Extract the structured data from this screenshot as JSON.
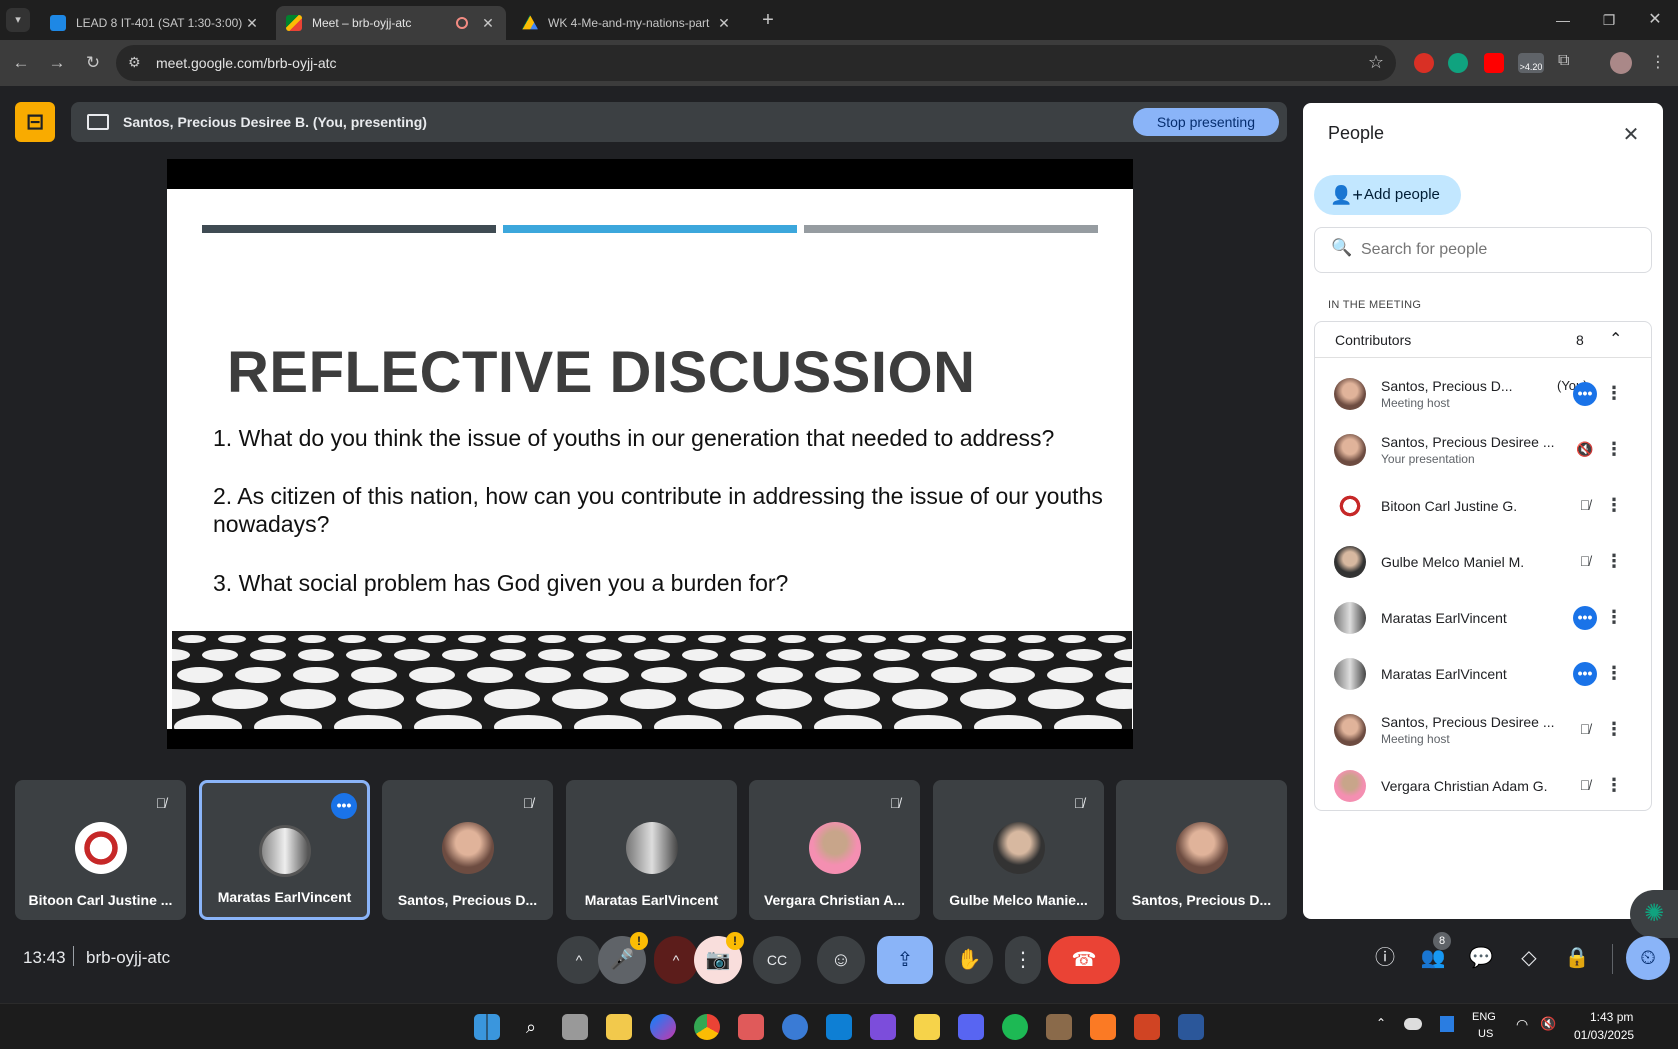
{
  "browser": {
    "tabs": [
      {
        "title": "LEAD 8 IT-401 (SAT 1:30-3:00)",
        "favicon": "classroom-icon"
      },
      {
        "title": "Meet – brb-oyjj-atc",
        "favicon": "meet-icon"
      },
      {
        "title": "WK 4-Me-and-my-nations-part",
        "favicon": "drive-icon"
      }
    ],
    "url": "meet.google.com/brb-oyjj-atc",
    "badge": ">4.20"
  },
  "presenting": {
    "label": "Santos, Precious Desiree B. (You, presenting)",
    "stop_label": "Stop presenting"
  },
  "slide": {
    "title": "REFLECTIVE DISCUSSION",
    "questions": [
      "1. What do you think the issue of youths in our generation that needed to address?",
      "2. As citizen of this nation, how can you contribute in addressing the issue of our youths nowadays?",
      "3. What social problem has God given you a burden for?"
    ]
  },
  "tiles": [
    {
      "name": "Bitoon Carl Justine ...",
      "muted": true
    },
    {
      "name": "Maratas EarlVincent",
      "muted": false,
      "selected": true
    },
    {
      "name": "Santos, Precious D...",
      "muted": true
    },
    {
      "name": "Maratas EarlVincent",
      "muted": false
    },
    {
      "name": "Vergara Christian A...",
      "muted": true
    },
    {
      "name": "Gulbe Melco Manie...",
      "muted": true
    },
    {
      "name": "Santos, Precious D...",
      "muted": false
    }
  ],
  "people": {
    "title": "People",
    "add_label": "Add people",
    "search_placeholder": "Search for people",
    "section": "IN THE MEETING",
    "group_label": "Contributors",
    "group_count": "8",
    "members": [
      {
        "name": "Santos, Precious D...",
        "you": "(You)",
        "sub": "Meeting host",
        "status": "more"
      },
      {
        "name": "Santos, Precious Desiree ...",
        "sub": "Your presentation",
        "status": "volume-off"
      },
      {
        "name": "Bitoon Carl Justine G.",
        "sub": "",
        "status": "mic-off"
      },
      {
        "name": "Gulbe Melco Maniel M.",
        "sub": "",
        "status": "mic-off"
      },
      {
        "name": "Maratas EarlVincent",
        "sub": "",
        "status": "more"
      },
      {
        "name": "Maratas EarlVincent",
        "sub": "",
        "status": "more"
      },
      {
        "name": "Santos, Precious Desiree ...",
        "sub": "Meeting host",
        "status": "mic-off"
      },
      {
        "name": "Vergara Christian Adam G.",
        "sub": "",
        "status": "mic-off"
      }
    ]
  },
  "bottom": {
    "time": "13:43",
    "code": "brb-oyjj-atc",
    "people_count": "8"
  },
  "taskbar": {
    "lang": "ENG",
    "region": "US",
    "time": "1:43 pm",
    "date": "01/03/2025"
  },
  "colors": {
    "meet_bg": "#202124",
    "accent": "#8ab4f8",
    "end_call": "#ea4335",
    "tile_bg": "#3c4043",
    "bar1": "#3f4b53",
    "bar2": "#3ca7dc",
    "bar3": "#969ca1"
  }
}
